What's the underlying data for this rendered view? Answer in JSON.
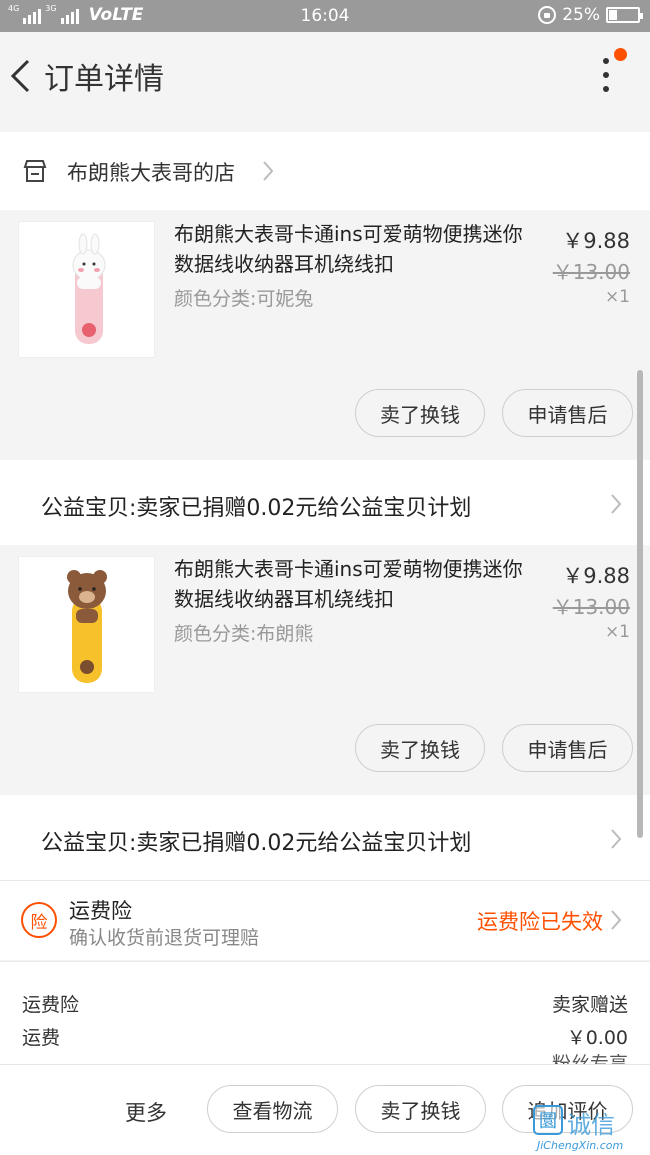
{
  "status_bar": {
    "network_1": "4G",
    "network_2": "3G",
    "volte": "VoLTE",
    "time": "16:04",
    "battery": "25%",
    "battery_level": 0.25
  },
  "header": {
    "title": "订单详情"
  },
  "shop": {
    "name": "布朗熊大表哥的店"
  },
  "products": [
    {
      "title": "布朗熊大表哥卡通ins可爱萌物便携迷你数据线收纳器耳机绕线扣",
      "attr": "颜色分类:可妮兔",
      "price": "￥9.88",
      "original_price": "￥13.00",
      "qty": "×1",
      "btn_sell": "卖了换钱",
      "btn_after_sale": "申请售后",
      "charity": "公益宝贝:卖家已捐赠0.02元给公益宝贝计划"
    },
    {
      "title": "布朗熊大表哥卡通ins可爱萌物便携迷你数据线收纳器耳机绕线扣",
      "attr": "颜色分类:布朗熊",
      "price": "￥9.88",
      "original_price": "￥13.00",
      "qty": "×1",
      "btn_sell": "卖了换钱",
      "btn_after_sale": "申请售后",
      "charity": "公益宝贝:卖家已捐赠0.02元给公益宝贝计划"
    }
  ],
  "insurance": {
    "icon_text": "险",
    "title": "运费险",
    "subtitle": "确认收货前退货可理赔",
    "status": "运费险已失效"
  },
  "fees": [
    {
      "label": "运费险",
      "value": "卖家赠送"
    },
    {
      "label": "运费",
      "value": "￥0.00"
    }
  ],
  "fees_partial": "粉丝专享",
  "bottom_bar": {
    "more": "更多",
    "logistics": "查看物流",
    "sell": "卖了换钱",
    "add_review": "追加评价"
  },
  "watermark": {
    "icon": "圜",
    "text": "诚信",
    "url": "JiChengXin.com"
  },
  "colors": {
    "accent": "#ff5000",
    "watermark": "#3a9ad9"
  }
}
